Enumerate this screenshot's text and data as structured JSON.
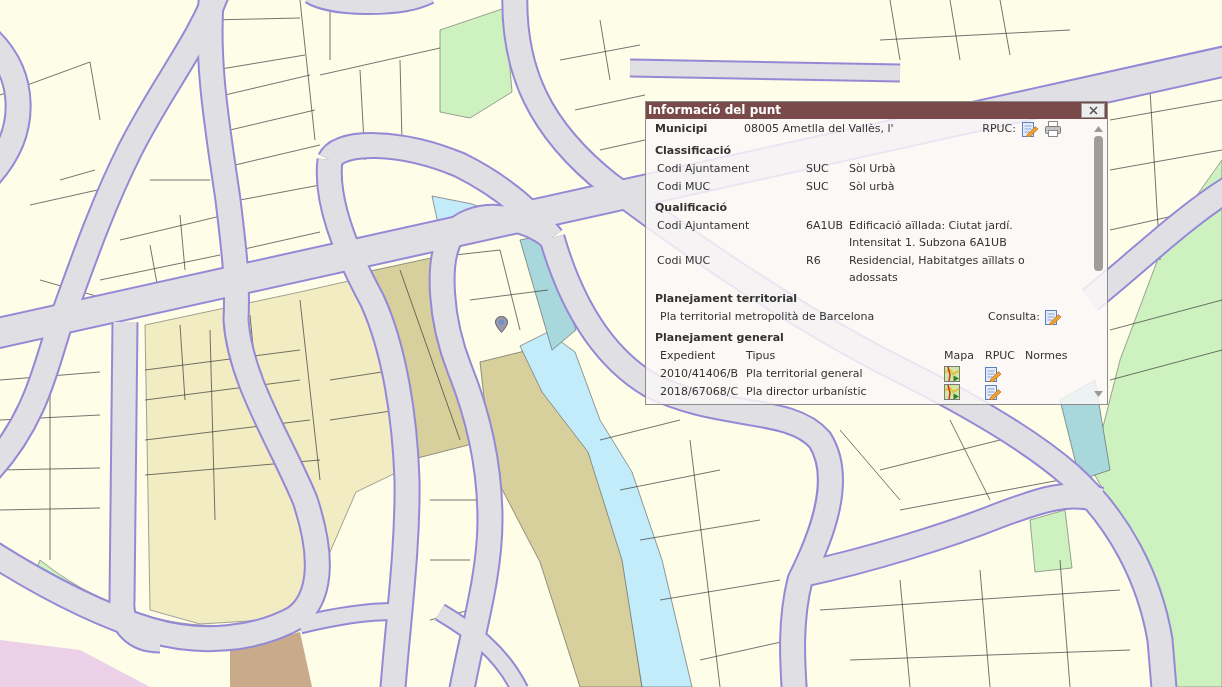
{
  "info_popup": {
    "title": "Informació del punt",
    "municipi": {
      "label": "Municipi",
      "value": "08005 Ametlla del Vallès, l'",
      "rpuc_label": "RPUC:"
    },
    "sections": [
      {
        "kind": "codes",
        "title": "Classificació",
        "rows": [
          {
            "label": "Codi Ajuntament",
            "code": "SUC",
            "description": "Sòl Urbà"
          },
          {
            "label": "Codi MUC",
            "code": "SUC",
            "description": "Sòl urbà"
          }
        ]
      },
      {
        "kind": "codes",
        "title": "Qualificació",
        "rows": [
          {
            "label": "Codi Ajuntament",
            "code": "6A1UB",
            "description": "Edificació aïllada: Ciutat jardí. Intensitat 1. Subzona 6A1UB"
          },
          {
            "label": "Codi MUC",
            "code": "R6",
            "description": "Residencial, Habitatges aïllats o adossats"
          }
        ]
      },
      {
        "kind": "plan",
        "title": "Planejament territorial",
        "text": "Pla territorial metropolità de Barcelona",
        "link_label": "Consulta:"
      },
      {
        "kind": "table",
        "title": "Planejament general",
        "columns": [
          "Expedient",
          "Tipus",
          "Mapa",
          "RPUC",
          "Normes"
        ],
        "rows": [
          {
            "expedient": "2010/41406/B",
            "tipus": "Pla territorial general"
          },
          {
            "expedient": "2018/67068/C",
            "tipus": "Pla director urbanístic"
          }
        ]
      }
    ]
  }
}
